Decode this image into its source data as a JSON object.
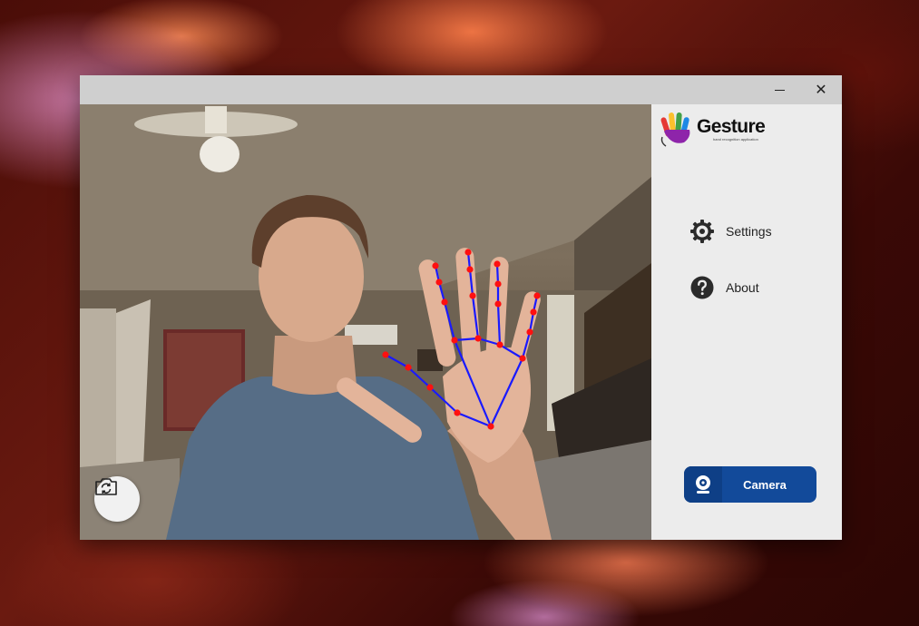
{
  "desktop": {
    "wallpaper": "antelope-canyon-sandstone"
  },
  "window": {
    "controls": {
      "minimize_icon": "minimize-icon",
      "close_icon": "close-icon",
      "close_glyph": "✕"
    }
  },
  "camera_view": {
    "overlay_color_lines": "#1a1aff",
    "overlay_color_points": "#ff1010",
    "switch_camera_icon": "camera-switch-icon"
  },
  "sidebar": {
    "logo": {
      "title": "Gesture",
      "subtitle": "hand recognition application"
    },
    "menu": [
      {
        "label": "Settings",
        "icon": "gear-icon"
      },
      {
        "label": "About",
        "icon": "question-icon"
      }
    ],
    "camera_button": {
      "label": "Camera",
      "icon": "webcam-icon",
      "color": "#124a9a"
    }
  }
}
